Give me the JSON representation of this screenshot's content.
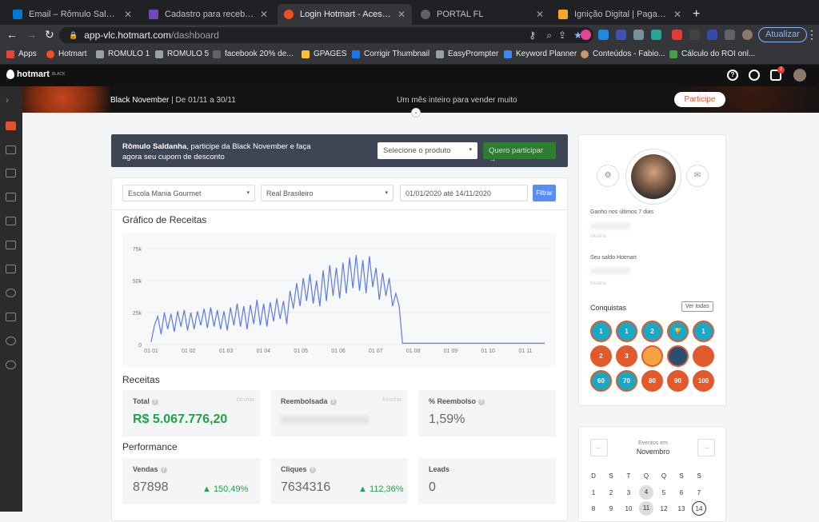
{
  "browser": {
    "tabs": [
      {
        "title": "Email – Rômulo Saldanha – Out",
        "color": "#0078d4",
        "active": false
      },
      {
        "title": "Cadastro para recebimento de",
        "color": "#7248b9",
        "active": false
      },
      {
        "title": "Login Hotmart - Acesse sua co",
        "color": "#f04e23",
        "active": true
      },
      {
        "title": "PORTAL FL",
        "color": "#5f6368",
        "active": false
      },
      {
        "title": "Ignição Digital | Pagamento",
        "color": "#f9a825",
        "active": false
      }
    ],
    "url_host": "app-vlc.hotmart.com",
    "url_path": "/dashboard",
    "update_label": "Atualizar",
    "bookmarks": [
      "Apps",
      "Hotmart",
      "ROMULO 1",
      "ROMULO 5",
      "facebook 20% de...",
      "GPAGES",
      "Corrigir Thumbnail",
      "EasyPrompter",
      "Keyword Planner",
      "Conteúdos - Fabio...",
      "Cálculo do ROI onl..."
    ]
  },
  "header": {
    "logo": "hotmart",
    "logo_sub": "BLACK",
    "notif_count": "2"
  },
  "banner": {
    "title": "Black November",
    "dates": "| De 01/11 a 30/11",
    "middle": "Um mês inteiro para vender muito",
    "cta": "Participe"
  },
  "promo": {
    "name": "Rômulo Saldanha",
    "text": ", participe da Black November e faça agora seu cupom de desconto",
    "select": "Selecione o produto",
    "button": "Quero participar"
  },
  "filters": {
    "product": "Escola Mania Gourmet",
    "currency": "Real Brasileiro",
    "dates": "01/01/2020 até 14/11/2020",
    "button": "Filtrar"
  },
  "chart_title": "Gráfico de Receitas",
  "chart_data": {
    "type": "line",
    "x_ticks": [
      "01 01",
      "01 02",
      "01 03",
      "01 04",
      "01 05",
      "01 06",
      "01 07",
      "01 08",
      "01 09",
      "01 10",
      "01 11"
    ],
    "y_ticks": [
      "0",
      "25k",
      "50k",
      "75k"
    ],
    "ylim": [
      0,
      80000
    ],
    "series": [
      {
        "values": [
          2000,
          15000,
          22000,
          8000,
          25000,
          12000,
          24000,
          10000,
          26000,
          14000,
          27000,
          11000,
          25000,
          12000,
          26000,
          15000,
          28000,
          13000,
          29000,
          14000,
          27000,
          12000,
          26000,
          11000,
          29000,
          15000,
          32000,
          14000,
          30000,
          12000,
          31000,
          16000,
          35000,
          15000,
          32000,
          14000,
          33000,
          18000,
          36000,
          20000,
          34000,
          16000,
          42000,
          28000,
          48000,
          30000,
          52000,
          34000,
          55000,
          32000,
          50000,
          30000,
          58000,
          34000,
          62000,
          38000,
          60000,
          36000,
          64000,
          40000,
          68000,
          44000,
          70000,
          42000,
          66000,
          40000,
          69000,
          45000,
          60000,
          35000,
          56000,
          38000,
          52000,
          30000,
          40000,
          30000,
          1000,
          1000,
          1000,
          1000,
          1000,
          1000,
          1000,
          1000,
          1000,
          1000,
          1000,
          1000,
          1000,
          1000,
          1000,
          1000,
          1000,
          1000,
          1000,
          1000,
          1000,
          1000,
          1000,
          1000,
          1000,
          1000,
          1000,
          1000,
          1000,
          1000,
          1000,
          1000,
          1000,
          1000,
          1000,
          1000,
          1000,
          1000,
          1000,
          1000,
          1000,
          1000,
          1000,
          1000
        ]
      }
    ]
  },
  "receitas": {
    "title": "Receitas",
    "total_label": "Total",
    "total_hint": "Ocultar",
    "total_value": "R$ 5.067.776,20",
    "reemb_label": "Reembolsada",
    "reemb_hint": "Mostrar",
    "pct_label": "% Reembolso",
    "pct_value": "1,59%"
  },
  "performance": {
    "title": "Performance",
    "vendas_label": "Vendas",
    "vendas_value": "87898",
    "vendas_change": "▲ 150,49%",
    "cliques_label": "Cliques",
    "cliques_value": "7634316",
    "cliques_change": "▲ 112,36%",
    "leads_label": "Leads",
    "leads_value": "0"
  },
  "right": {
    "gain_label": "Ganho nos últimos 7 dias",
    "show1": "Mostrar",
    "balance_label": "Seu saldo Hotmart",
    "show2": "Mostrar",
    "conq_title": "Conquistas",
    "ver_todas": "Ver todas",
    "badges": [
      "1",
      "1",
      "2",
      "🏆",
      "1",
      "2",
      "3",
      "",
      "",
      "",
      "60",
      "70",
      "80",
      "90",
      "100"
    ]
  },
  "calendar": {
    "top": "Eventos em",
    "month": "Novembro",
    "days": [
      "D",
      "S",
      "T",
      "Q",
      "Q",
      "S",
      "S"
    ],
    "week1": [
      "1",
      "2",
      "3",
      "4",
      "5",
      "6",
      "7"
    ],
    "week2": [
      "8",
      "9",
      "10",
      "11",
      "12",
      "13",
      "14"
    ]
  }
}
